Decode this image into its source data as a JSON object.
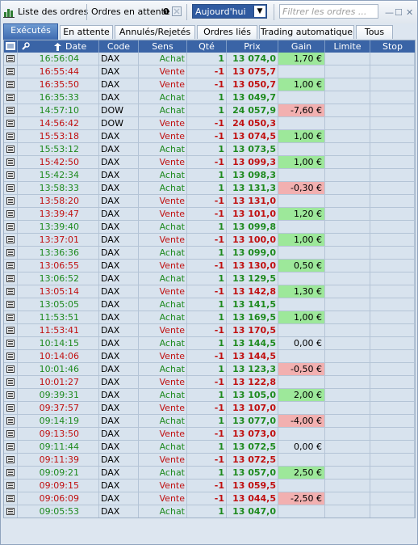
{
  "toolbar": {
    "title": "Liste des ordres",
    "pending_label": "Ordres en attente",
    "pending_count": "0",
    "period_value": "Aujourd'hui",
    "filter_placeholder": "Filtrer les ordres ...",
    "minimize": "—",
    "restore": "☐",
    "close": "✕"
  },
  "tabs": [
    {
      "label": "Exécutés",
      "active": true
    },
    {
      "label": "En attente",
      "active": false
    },
    {
      "label": "Annulés/Rejetés",
      "active": false
    },
    {
      "label": "Ordres liés",
      "active": false
    },
    {
      "label": "Trading automatique",
      "active": false
    },
    {
      "label": "Tous",
      "active": false
    }
  ],
  "columns": {
    "date": "Date",
    "code": "Code",
    "sens": "Sens",
    "qte": "Qté",
    "prix": "Prix",
    "gain": "Gain",
    "limite": "Limite",
    "stop": "Stop"
  },
  "colors": {
    "buy": "#1e8a1e",
    "sell": "#c01010",
    "gain_positive": "#9de89a",
    "gain_negative": "#f2b0b0",
    "header": "#3a64a6",
    "active_tab": "#3e6ab0"
  },
  "icons": {
    "list": "order-list-icon",
    "cancel": "cancel-all-icon",
    "wrench": "wrench-icon",
    "sort": "sort-ascending-icon",
    "row": "order-detail-icon"
  },
  "rows": [
    {
      "date": "16:56:04",
      "code": "DAX",
      "sens": "Achat",
      "qte": "1",
      "prix": "13 074,0",
      "gain": "1,70 €",
      "side": "buy"
    },
    {
      "date": "16:55:44",
      "code": "DAX",
      "sens": "Vente",
      "qte": "-1",
      "prix": "13 075,7",
      "gain": "",
      "side": "sell"
    },
    {
      "date": "16:35:50",
      "code": "DAX",
      "sens": "Vente",
      "qte": "-1",
      "prix": "13 050,7",
      "gain": "1,00 €",
      "side": "sell"
    },
    {
      "date": "16:35:33",
      "code": "DAX",
      "sens": "Achat",
      "qte": "1",
      "prix": "13 049,7",
      "gain": "",
      "side": "buy"
    },
    {
      "date": "14:57:10",
      "code": "DOW",
      "sens": "Achat",
      "qte": "1",
      "prix": "24 057,9",
      "gain": "-7,60 €",
      "side": "buy"
    },
    {
      "date": "14:56:42",
      "code": "DOW",
      "sens": "Vente",
      "qte": "-1",
      "prix": "24 050,3",
      "gain": "",
      "side": "sell"
    },
    {
      "date": "15:53:18",
      "code": "DAX",
      "sens": "Vente",
      "qte": "-1",
      "prix": "13 074,5",
      "gain": "1,00 €",
      "side": "sell"
    },
    {
      "date": "15:53:12",
      "code": "DAX",
      "sens": "Achat",
      "qte": "1",
      "prix": "13 073,5",
      "gain": "",
      "side": "buy"
    },
    {
      "date": "15:42:50",
      "code": "DAX",
      "sens": "Vente",
      "qte": "-1",
      "prix": "13 099,3",
      "gain": "1,00 €",
      "side": "sell"
    },
    {
      "date": "15:42:34",
      "code": "DAX",
      "sens": "Achat",
      "qte": "1",
      "prix": "13 098,3",
      "gain": "",
      "side": "buy"
    },
    {
      "date": "13:58:33",
      "code": "DAX",
      "sens": "Achat",
      "qte": "1",
      "prix": "13 131,3",
      "gain": "-0,30 €",
      "side": "buy"
    },
    {
      "date": "13:58:20",
      "code": "DAX",
      "sens": "Vente",
      "qte": "-1",
      "prix": "13 131,0",
      "gain": "",
      "side": "sell"
    },
    {
      "date": "13:39:47",
      "code": "DAX",
      "sens": "Vente",
      "qte": "-1",
      "prix": "13 101,0",
      "gain": "1,20 €",
      "side": "sell"
    },
    {
      "date": "13:39:40",
      "code": "DAX",
      "sens": "Achat",
      "qte": "1",
      "prix": "13 099,8",
      "gain": "",
      "side": "buy"
    },
    {
      "date": "13:37:01",
      "code": "DAX",
      "sens": "Vente",
      "qte": "-1",
      "prix": "13 100,0",
      "gain": "1,00 €",
      "side": "sell"
    },
    {
      "date": "13:36:36",
      "code": "DAX",
      "sens": "Achat",
      "qte": "1",
      "prix": "13 099,0",
      "gain": "",
      "side": "buy"
    },
    {
      "date": "13:06:55",
      "code": "DAX",
      "sens": "Vente",
      "qte": "-1",
      "prix": "13 130,0",
      "gain": "0,50 €",
      "side": "sell"
    },
    {
      "date": "13:06:52",
      "code": "DAX",
      "sens": "Achat",
      "qte": "1",
      "prix": "13 129,5",
      "gain": "",
      "side": "buy"
    },
    {
      "date": "13:05:14",
      "code": "DAX",
      "sens": "Vente",
      "qte": "-1",
      "prix": "13 142,8",
      "gain": "1,30 €",
      "side": "sell"
    },
    {
      "date": "13:05:05",
      "code": "DAX",
      "sens": "Achat",
      "qte": "1",
      "prix": "13 141,5",
      "gain": "",
      "side": "buy"
    },
    {
      "date": "11:53:51",
      "code": "DAX",
      "sens": "Achat",
      "qte": "1",
      "prix": "13 169,5",
      "gain": "1,00 €",
      "side": "buy"
    },
    {
      "date": "11:53:41",
      "code": "DAX",
      "sens": "Vente",
      "qte": "-1",
      "prix": "13 170,5",
      "gain": "",
      "side": "sell"
    },
    {
      "date": "10:14:15",
      "code": "DAX",
      "sens": "Achat",
      "qte": "1",
      "prix": "13 144,5",
      "gain": "0,00 €",
      "side": "buy"
    },
    {
      "date": "10:14:06",
      "code": "DAX",
      "sens": "Vente",
      "qte": "-1",
      "prix": "13 144,5",
      "gain": "",
      "side": "sell"
    },
    {
      "date": "10:01:46",
      "code": "DAX",
      "sens": "Achat",
      "qte": "1",
      "prix": "13 123,3",
      "gain": "-0,50 €",
      "side": "buy"
    },
    {
      "date": "10:01:27",
      "code": "DAX",
      "sens": "Vente",
      "qte": "-1",
      "prix": "13 122,8",
      "gain": "",
      "side": "sell"
    },
    {
      "date": "09:39:31",
      "code": "DAX",
      "sens": "Achat",
      "qte": "1",
      "prix": "13 105,0",
      "gain": "2,00 €",
      "side": "buy"
    },
    {
      "date": "09:37:57",
      "code": "DAX",
      "sens": "Vente",
      "qte": "-1",
      "prix": "13 107,0",
      "gain": "",
      "side": "sell"
    },
    {
      "date": "09:14:19",
      "code": "DAX",
      "sens": "Achat",
      "qte": "1",
      "prix": "13 077,0",
      "gain": "-4,00 €",
      "side": "buy"
    },
    {
      "date": "09:13:50",
      "code": "DAX",
      "sens": "Vente",
      "qte": "-1",
      "prix": "13 073,0",
      "gain": "",
      "side": "sell"
    },
    {
      "date": "09:11:44",
      "code": "DAX",
      "sens": "Achat",
      "qte": "1",
      "prix": "13 072,5",
      "gain": "0,00 €",
      "side": "buy"
    },
    {
      "date": "09:11:39",
      "code": "DAX",
      "sens": "Vente",
      "qte": "-1",
      "prix": "13 072,5",
      "gain": "",
      "side": "sell"
    },
    {
      "date": "09:09:21",
      "code": "DAX",
      "sens": "Achat",
      "qte": "1",
      "prix": "13 057,0",
      "gain": "2,50 €",
      "side": "buy"
    },
    {
      "date": "09:09:15",
      "code": "DAX",
      "sens": "Vente",
      "qte": "-1",
      "prix": "13 059,5",
      "gain": "",
      "side": "sell"
    },
    {
      "date": "09:06:09",
      "code": "DAX",
      "sens": "Vente",
      "qte": "-1",
      "prix": "13 044,5",
      "gain": "-2,50 €",
      "side": "sell"
    },
    {
      "date": "09:05:53",
      "code": "DAX",
      "sens": "Achat",
      "qte": "1",
      "prix": "13 047,0",
      "gain": "",
      "side": "buy"
    }
  ]
}
